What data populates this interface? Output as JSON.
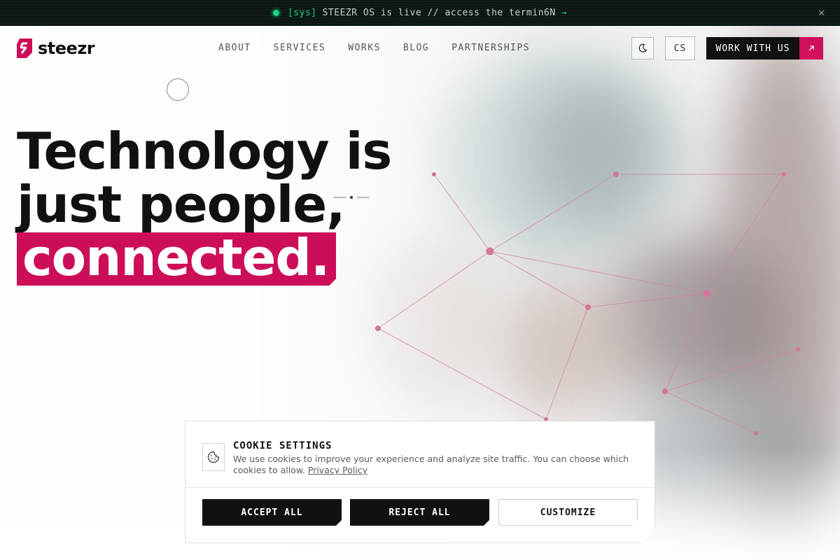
{
  "announcement": {
    "tag": "[sys]",
    "message": "STEEZR OS is live // access the termin6N",
    "arrow": "→",
    "close_icon": "close-icon"
  },
  "header": {
    "brand": "steezr",
    "nav": [
      "ABOUT",
      "SERVICES",
      "WORKS",
      "BLOG",
      "PARTNERSHIPS"
    ],
    "theme_toggle_icon": "moon-icon",
    "language": "CS",
    "cta_label": "WORK WITH US",
    "cta_icon": "arrow-up-right-icon"
  },
  "hero": {
    "line1": "Technology is",
    "line2": "just people,",
    "highlight": "connected."
  },
  "cookie": {
    "icon": "cookie-icon",
    "title": "COOKIE SETTINGS",
    "text": "We use cookies to improve your experience and analyze site traffic. You can choose which cookies to allow.",
    "link": "Privacy Policy",
    "accept": "ACCEPT ALL",
    "reject": "REJECT ALL",
    "customize": "CUSTOMIZE"
  },
  "colors": {
    "accent": "#cc0e58",
    "dark": "#111111",
    "status_green": "#1fd17a"
  }
}
